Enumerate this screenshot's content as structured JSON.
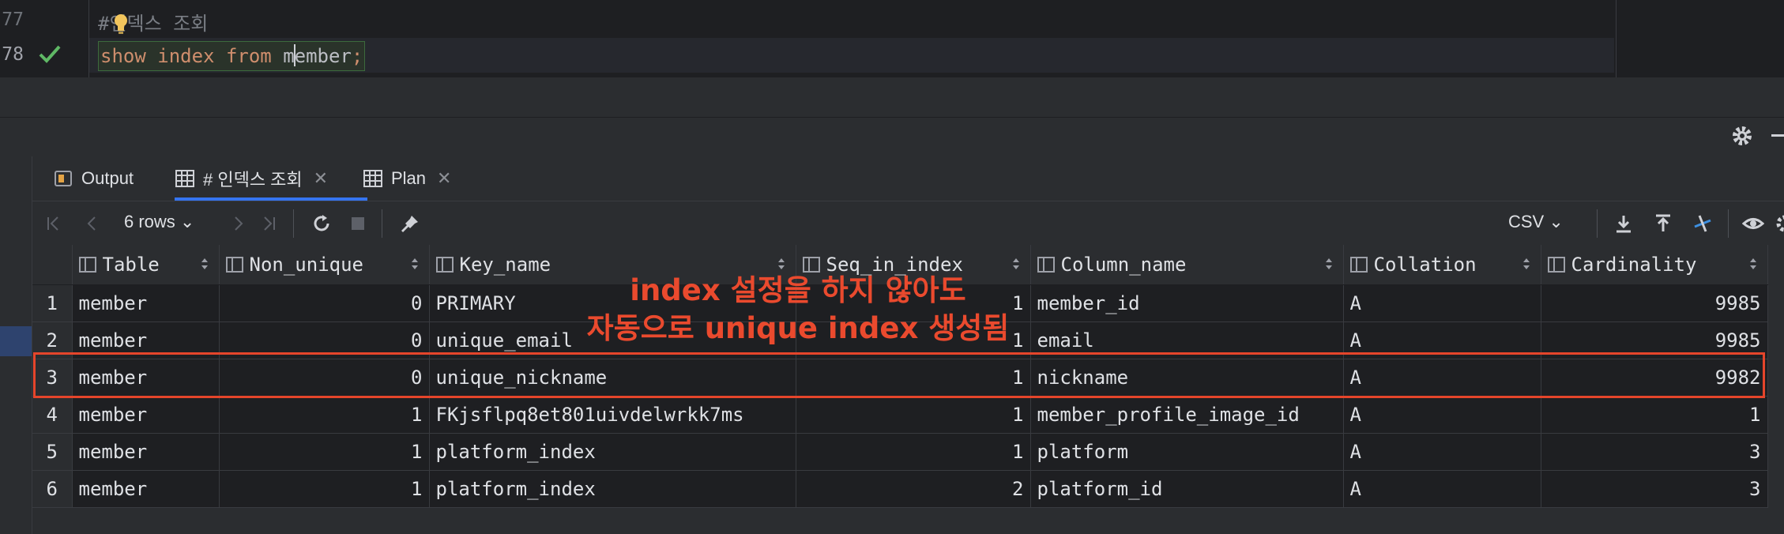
{
  "editor": {
    "line_numbers": [
      "77",
      "78"
    ],
    "comment": "#인덱스 조회",
    "code": {
      "kw1": "show",
      "kw2": "index",
      "kw3": "from",
      "ident_before_caret": "m",
      "ident_after_caret": "ember",
      "semicolon": ";"
    }
  },
  "tabs": [
    {
      "label": "Output"
    },
    {
      "label": "# 인덱스 조회"
    },
    {
      "label": "Plan"
    }
  ],
  "toolbar": {
    "rows_label": "6 rows",
    "export_format": "CSV"
  },
  "grid": {
    "columns": [
      "Table",
      "Non_unique",
      "Key_name",
      "Seq_in_index",
      "Column_name",
      "Collation",
      "Cardinality"
    ],
    "rows": [
      {
        "n": "1",
        "table": "member",
        "non_unique": "0",
        "key_name": "PRIMARY",
        "seq": "1",
        "column": "member_id",
        "collation": "A",
        "cardinality": "9985"
      },
      {
        "n": "2",
        "table": "member",
        "non_unique": "0",
        "key_name": "unique_email",
        "seq": "1",
        "column": "email",
        "collation": "A",
        "cardinality": "9985"
      },
      {
        "n": "3",
        "table": "member",
        "non_unique": "0",
        "key_name": "unique_nickname",
        "seq": "1",
        "column": "nickname",
        "collation": "A",
        "cardinality": "9982"
      },
      {
        "n": "4",
        "table": "member",
        "non_unique": "1",
        "key_name": "FKjsflpq8et801uivdelwrkk7ms",
        "seq": "1",
        "column": "member_profile_image_id",
        "collation": "A",
        "cardinality": "1"
      },
      {
        "n": "5",
        "table": "member",
        "non_unique": "1",
        "key_name": "platform_index",
        "seq": "1",
        "column": "platform",
        "collation": "A",
        "cardinality": "3"
      },
      {
        "n": "6",
        "table": "member",
        "non_unique": "1",
        "key_name": "platform_index",
        "seq": "2",
        "column": "platform_id",
        "collation": "A",
        "cardinality": "3"
      }
    ]
  },
  "annotation": {
    "line1": "index 설정을 하지 않아도",
    "line2": "자동으로 unique index 생성됨"
  },
  "colors": {
    "highlight": "#e5452b",
    "accent": "#3574f0",
    "keyword": "#cf8e6d"
  }
}
